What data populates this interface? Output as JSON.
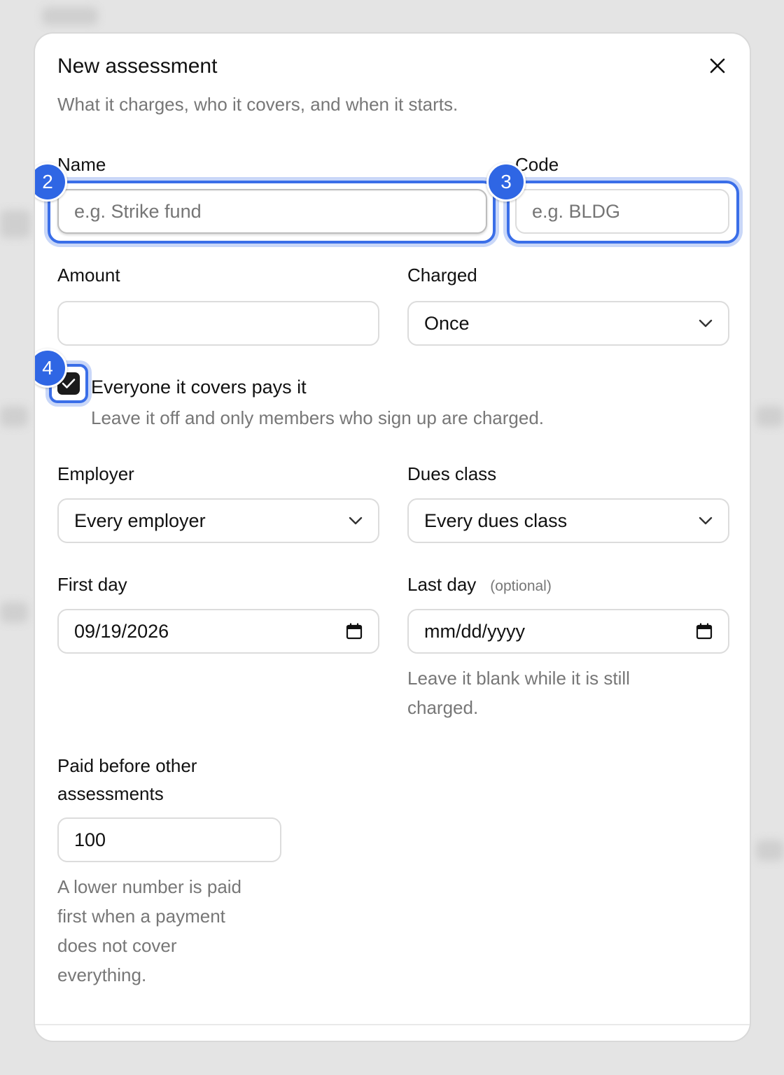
{
  "modal": {
    "title": "New assessment",
    "subtitle": "What it charges, who it covers, and when it starts.",
    "close_icon": "close-icon"
  },
  "form": {
    "name": {
      "label": "Name",
      "value": "",
      "placeholder": "e.g. Strike fund",
      "badge": "2"
    },
    "code": {
      "label": "Code",
      "value": "",
      "placeholder": "e.g. BLDG",
      "badge": "3"
    },
    "amount": {
      "label": "Amount",
      "value": ""
    },
    "charged": {
      "label": "Charged",
      "selected": "Once"
    },
    "everyone_pays": {
      "label": "Everyone it covers pays it",
      "help": "Leave it off and only members who sign up are charged.",
      "checked": true,
      "badge": "4"
    },
    "employer": {
      "label": "Employer",
      "selected": "Every employer"
    },
    "dues_class": {
      "label": "Dues class",
      "selected": "Every dues class"
    },
    "first_day": {
      "label": "First day",
      "value": "09/19/2026"
    },
    "last_day": {
      "label": "Last day",
      "optional": "(optional)",
      "value": "mm/dd/yyyy",
      "help_line1": "Leave it blank while it is still",
      "help_line2": "charged."
    },
    "priority": {
      "label_line1": "Paid before other",
      "label_line2": "assessments",
      "value": "100",
      "help_line1": "A lower number is paid",
      "help_line2": "first when a payment",
      "help_line3": "does not cover",
      "help_line4": "everything."
    }
  },
  "colors": {
    "accent": "#3a6ee8",
    "badge": "#2f66e4",
    "checkbox": "#1b1b1b"
  }
}
